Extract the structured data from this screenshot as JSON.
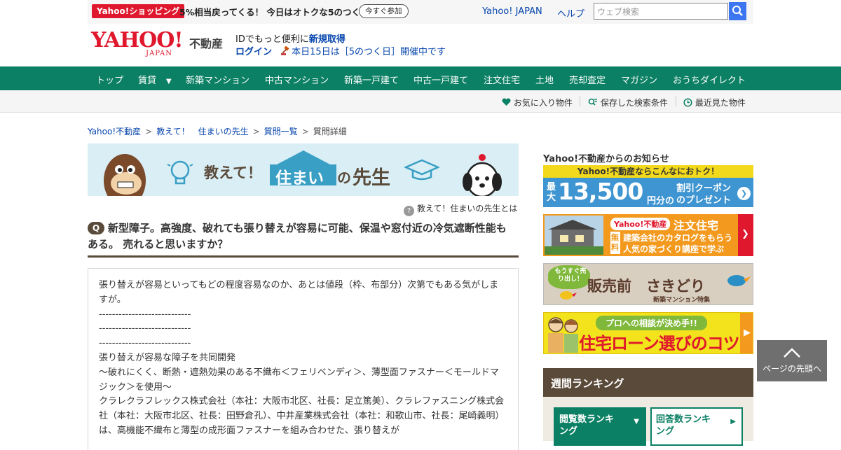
{
  "promo": {
    "badge": "Yahoo!ショッピング",
    "text": "5%相当戻ってくる！ 今日はオトクな5のつく日",
    "button": "今すぐ参加"
  },
  "header": {
    "yahoo_japan_link": "Yahoo! JAPAN",
    "help_link": "ヘルプ",
    "search_placeholder": "ウェブ検索",
    "logo_main": "YAHOO!",
    "logo_japan": "JAPAN",
    "logo_sub": "不動産",
    "id_prefix": "IDでもっと便利に",
    "id_signup": "新規取得",
    "login": "ログイン",
    "event": "本日15日は［5のつく日］開催中です"
  },
  "nav": [
    "トップ",
    "賃貸",
    "新築マンション",
    "中古マンション",
    "新築一戸建て",
    "中古一戸建て",
    "注文住宅",
    "土地",
    "売却査定",
    "マガジン",
    "おうちダイレクト"
  ],
  "subnav": {
    "favorites": "お気に入り物件",
    "saved_search": "保存した検索条件",
    "recent": "最近見た物件"
  },
  "breadcrumb": {
    "items": [
      "Yahoo!不動産",
      "教えて！　住まいの先生",
      "質問一覧"
    ],
    "current": "質問詳細"
  },
  "banner": {
    "teach": "教えて！",
    "sumai": "住まい",
    "no": "の",
    "sensei": "先生"
  },
  "about_link": "教えて！住まいの先生とは",
  "question": {
    "badge": "Q",
    "title": "新型障子。高強度、破れても張り替えが容易に可能、保温や窓付近の冷気遮断性能もある。 売れると思いますか？",
    "body_lines": [
      "張り替えが容易といってもどの程度容易なのか、あとは値段（枠、布部分）次第でもある気がしますが。",
      "----------------------------",
      "----------------------------",
      "----------------------------",
      "張り替えが容易な障子を共同開発",
      "～破れにくく、断熱・遮熱効果のある不織布＜フェリベンディ＞、薄型面ファスナー＜モールドマジック＞を使用～",
      "クラレクラフレックス株式会社（本社：大阪市北区、社長：足立篤美）、クラレファスニング株式会社（本社：大阪市北区、社長：田野倉孔）、中井産業株式会社（本社：和歌山市、社長：尾崎義明）は、高機能不織布と薄型の成形面ファスナーを組み合わせた、張り替えが"
    ]
  },
  "sidebar": {
    "notice_title": "Yahoo!不動産からのお知らせ",
    "coupon_head": "Yahoo!不動産ならこんなにおトク！",
    "coupon_max": "最大",
    "coupon_amount": "13,500",
    "coupon_unit": "円分の",
    "coupon_label1": "割引クーポン",
    "coupon_label2": "のプレゼント",
    "chumon_brand": "Yahoo!不動産",
    "chumon_title": "注文住宅",
    "chumon_free": "無料",
    "chumon_line1": "建築会社のカタログをもらう",
    "chumon_line2": "人気の家づくり講座で学ぶ",
    "hanbai_badge": "もうすぐ売り出し！",
    "hanbai_title": "販売前　さきどり",
    "hanbai_sub": "新築マンション特集",
    "loan_bubble": "プロへの相談が決め手!!",
    "loan_title": "住宅ローン選びのコツ",
    "ranking_title": "週間ランキング",
    "rank_tab1": "閲覧数ランキング",
    "rank_tab2": "回答数ランキング"
  },
  "to_top": "ページの先頭へ",
  "colors": {
    "nav_green": "#0b8064",
    "yahoo_red": "#e0182d",
    "brown": "#5a4a3a",
    "link_blue": "#0645ad"
  }
}
